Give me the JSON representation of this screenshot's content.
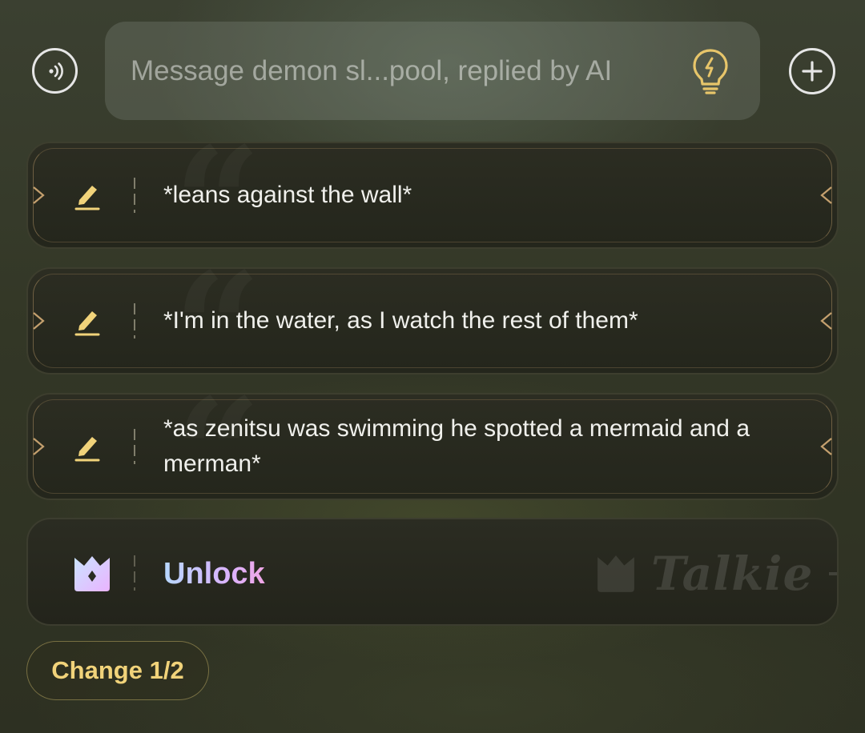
{
  "input_bar": {
    "placeholder": "Message demon sl...pool, replied by AI",
    "value": "",
    "left_icon": "voice-call-icon",
    "hint_icon": "lightbulb-icon",
    "right_icon": "plus-circle-icon"
  },
  "suggestions": [
    {
      "text": "*leans against the wall*",
      "icon": "edit-pencil-icon"
    },
    {
      "text": "*I'm in the water, as I watch the rest of them*",
      "icon": "edit-pencil-icon"
    },
    {
      "text": "*as zenitsu was swimming he spotted a mermaid and a merman*",
      "icon": "edit-pencil-icon"
    }
  ],
  "unlock": {
    "label": "Unlock",
    "icon": "crown-icon",
    "watermark": "Talkie"
  },
  "change_button": {
    "label": "Change 1/2"
  },
  "colors": {
    "accent_gold": "#f1d37a",
    "card_background": "#2c2d22",
    "frame_gold": "#c4a06e",
    "unlock_gradient": [
      "#b7d8ff",
      "#d8b5ff",
      "#f0a6e6"
    ]
  }
}
